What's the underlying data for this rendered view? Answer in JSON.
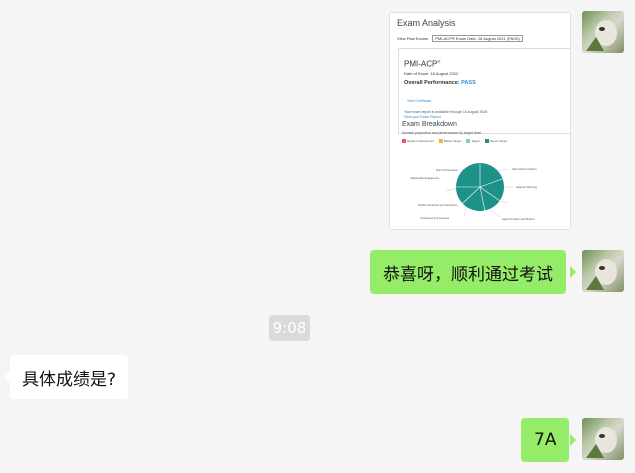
{
  "chat": {
    "screenshot": {
      "title": "Exam Analysis",
      "filter_label": "View Past Exams",
      "filter_value": "PMI-ACP® Exam Date: 16 August 2021 (PASS)",
      "certification": "PMI-ACP",
      "cert_mark": "®",
      "exam_date": "Date of Exam: 16 August 2022",
      "overall_label": "Overall Performance:",
      "overall_value": "PASS",
      "view_certificate": "View Certificate",
      "report_note": "Your exam report is available through 16 August 2028",
      "report_link": "View your Exam Report",
      "breakdown_title": "Exam Breakdown",
      "breakdown_subtitle": "Domain proportion and performance by target level",
      "legend": [
        {
          "label": "Needs Improvement",
          "color": "#e05a63"
        },
        {
          "label": "Below Target",
          "color": "#f2b33d"
        },
        {
          "label": "Target",
          "color": "#7fd0c7"
        },
        {
          "label": "Above Target",
          "color": "#1e9189"
        }
      ],
      "pie_labels": [
        "Stakeholder Engagement",
        "Team Performance",
        "Value-Driven Delivery",
        "Adaptive Planning",
        "Problem Detection and Resolution",
        "Continuous Improvement",
        "Agile Principles and Mindset"
      ]
    },
    "messages": {
      "congrats": "恭喜呀，顺利通过考试",
      "timestamp": "9:08",
      "question": "具体成绩是?",
      "answer": "7A"
    }
  }
}
